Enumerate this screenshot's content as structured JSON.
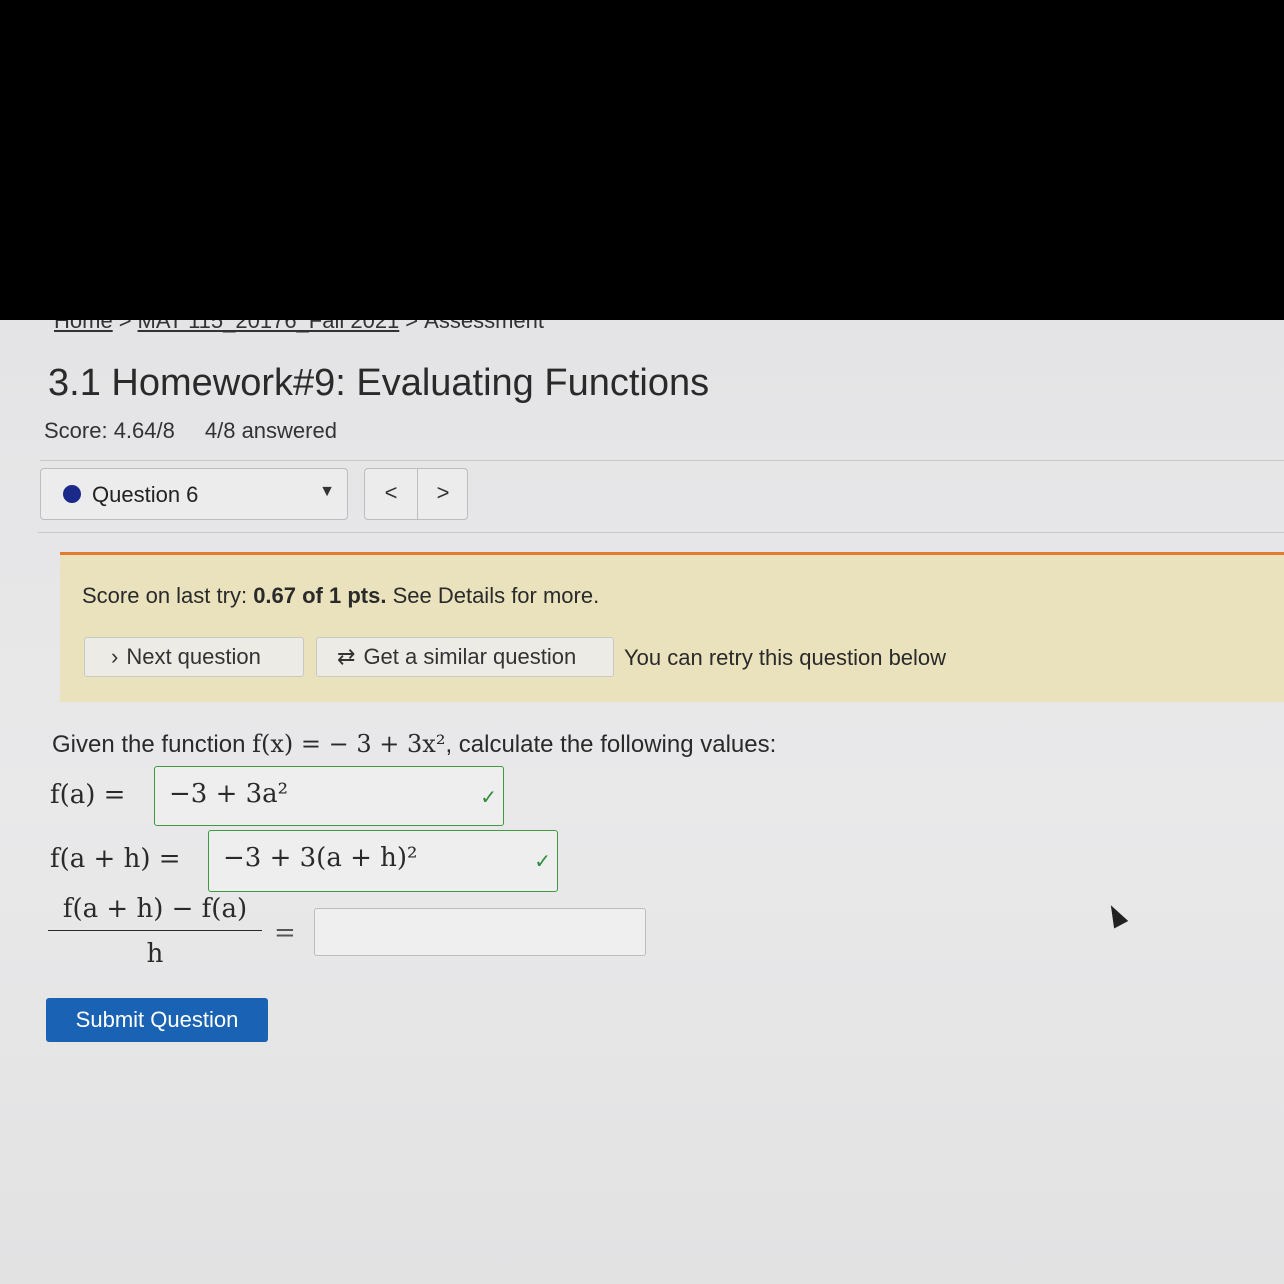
{
  "breadcrumb": {
    "home": "Home",
    "course": "MAT 115_20176_Fall 2021",
    "current": "Assessment",
    "sep": ">"
  },
  "page_title": "3.1 Homework#9: Evaluating Functions",
  "score": {
    "score_text": "Score: 4.64/8",
    "answered_text": "4/8 answered"
  },
  "question_nav": {
    "selected": "Question 6",
    "prev": "<",
    "next": ">"
  },
  "banner": {
    "prefix": "Score on last try: ",
    "score_bold": "0.67 of 1 pts.",
    "suffix": " See Details for more.",
    "next_label": "Next question",
    "similar_label": "Get a similar question",
    "retry_text": "You can retry this question below",
    "icons": {
      "next": "chevron-right-icon",
      "similar": "refresh-icon"
    },
    "colors": {
      "background": "#e9e2bd",
      "accent": "#e27b2f"
    }
  },
  "question": {
    "prefix": "Given the function ",
    "function": "f(x) = − 3 + 3x²",
    "suffix": ", calculate the following values:",
    "rows": [
      {
        "lhs": "f(a) =",
        "answer": "−3 + 3a²",
        "status": "correct"
      },
      {
        "lhs": "f(a + h) =",
        "answer": "−3 + 3(a + h)²",
        "status": "correct"
      }
    ],
    "fraction": {
      "numerator": "f(a + h) − f(a)",
      "denominator": "h",
      "equals": "=",
      "answer": ""
    }
  },
  "submit_label": "Submit Question",
  "colors": {
    "correct": "#2e8b3a",
    "primary": "#1a62b3"
  }
}
